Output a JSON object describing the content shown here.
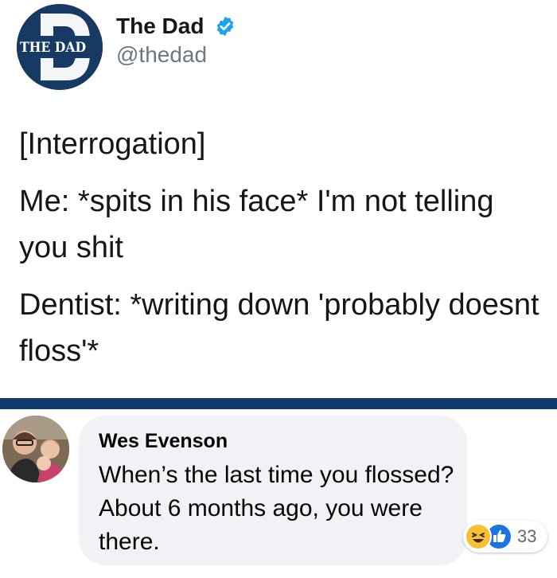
{
  "tweet": {
    "logo_text": "THE DAD",
    "author_name": "The Dad",
    "verified": true,
    "handle": "@thedad",
    "lines": [
      "[Interrogation]",
      "Me: *spits in his face* I'm not telling you shit",
      "Dentist: *writing down 'probably doesnt floss'*"
    ]
  },
  "colors": {
    "logo_bg": "#163a63",
    "divider": "#0e3a6a",
    "verified": "#1da1f2",
    "bubble": "#f0f2f5",
    "like": "#1b74e4",
    "haha": "#f7c133"
  },
  "comment": {
    "author": "Wes Evenson",
    "text": "When’s the last time you flossed? About 6 months ago, you were there.",
    "reactions": {
      "icons": [
        "haha-icon",
        "like-icon"
      ],
      "count": "33"
    }
  }
}
